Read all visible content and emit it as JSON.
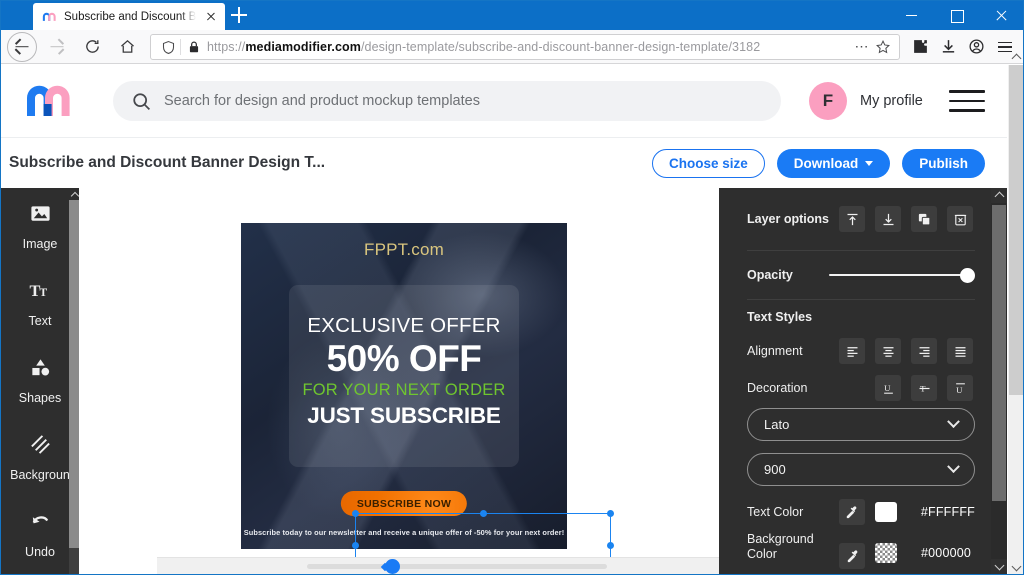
{
  "browser": {
    "tab": {
      "title": "Subscribe and Discount Banner",
      "favicon": "mediamodifier-logo-icon",
      "close_icon": "close-icon"
    },
    "new_tab_icon": "plus-icon",
    "window_controls": {
      "minimize": "minimize-icon",
      "maximize": "maximize-icon",
      "close": "close-icon"
    },
    "nav": {
      "back": "back-arrow-icon",
      "forward": "forward-arrow-icon",
      "reload": "reload-icon",
      "home": "home-icon"
    },
    "url": {
      "scheme": "https://",
      "domain": "mediamodifier.com",
      "path": "/design-template/subscribe-and-discount-banner-design-template/3182",
      "shield_icon": "shield-icon",
      "lock_icon": "lock-icon",
      "page_actions_icon": "ellipsis-icon",
      "bookmark_icon": "star-icon"
    },
    "toolbar": {
      "extensions_icon": "puzzle-icon",
      "downloads_icon": "download-icon",
      "account_icon": "account-icon",
      "app_menu_icon": "hamburger-menu-icon"
    }
  },
  "site_header": {
    "logo": "mediamodifier-logo",
    "search": {
      "placeholder": "Search for design and product mockup templates",
      "icon": "search-icon"
    },
    "avatar_initial": "F",
    "profile_label": "My profile",
    "menu_icon": "hamburger-menu-icon"
  },
  "doc_bar": {
    "title": "Subscribe and Discount Banner Design T...",
    "choose_size": "Choose size",
    "download": "Download",
    "publish": "Publish"
  },
  "left_rail": {
    "items": [
      {
        "label": "Image",
        "icon": "image-icon"
      },
      {
        "label": "Text",
        "icon": "text-icon"
      },
      {
        "label": "Shapes",
        "icon": "shapes-icon"
      },
      {
        "label": "Backgroun",
        "icon": "background-icon"
      },
      {
        "label": "Undo",
        "icon": "undo-icon"
      }
    ]
  },
  "design": {
    "brand": "FPPT.com",
    "headline": "EXCLUSIVE OFFER",
    "offer": "50% OFF",
    "subline": "FOR YOUR NEXT ORDER",
    "callout": "JUST SUBSCRIBE",
    "cta": "SUBSCRIBE NOW",
    "footer": "Subscribe today to our newsletter and receive a unique offer of -50% for your next order!",
    "colors": {
      "background": "#1f2a40",
      "brand_text": "#d9c57e",
      "subline_text": "#6fc62f",
      "cta_bg": "#f07000",
      "selection": "#1b84f0"
    }
  },
  "right_panel": {
    "layer_options": {
      "label": "Layer options",
      "buttons": [
        {
          "name": "bring-to-front",
          "icon": "bring-to-front-icon"
        },
        {
          "name": "send-to-back",
          "icon": "send-to-back-icon"
        },
        {
          "name": "duplicate",
          "icon": "duplicate-icon"
        },
        {
          "name": "delete",
          "icon": "delete-icon"
        }
      ]
    },
    "opacity": {
      "label": "Opacity",
      "value": 100
    },
    "text_styles": {
      "label": "Text Styles",
      "alignment": {
        "label": "Alignment",
        "options": [
          "align-left",
          "align-center",
          "align-right",
          "align-justify"
        ]
      },
      "decoration": {
        "label": "Decoration",
        "options": [
          "underline",
          "strikethrough",
          "overline"
        ]
      },
      "font_family": "Lato",
      "font_weight": "900",
      "text_color": {
        "label": "Text Color",
        "hex": "#FFFFFF",
        "picker_icon": "eyedropper-icon"
      },
      "background_color": {
        "label": "Background Color",
        "hex": "#000000",
        "picker_icon": "eyedropper-icon"
      }
    }
  }
}
